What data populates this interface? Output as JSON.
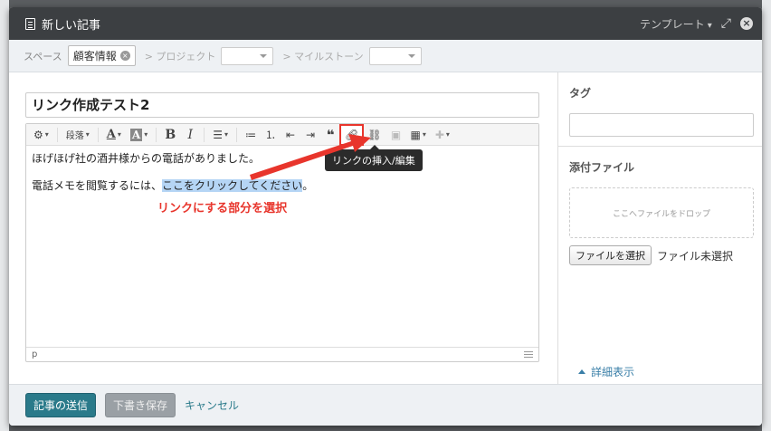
{
  "modal": {
    "title": "新しい記事",
    "template_label": "テンプレート"
  },
  "meta": {
    "space_label": "スペース",
    "space_value": "顧客情報",
    "project_label": "> プロジェクト",
    "milestone_label": "> マイルストーン"
  },
  "editor": {
    "title_value": "リンク作成テスト2",
    "toolbar": {
      "paragraph_label": "段落"
    },
    "content": {
      "line1": "ほげほげ社の酒井様からの電話がありました。",
      "line2_before": "電話メモを閲覧するには、",
      "line2_selected": "ここをクリックしてください",
      "line2_after": "。"
    },
    "status_path": "p",
    "tooltip": "リンクの挿入/編集"
  },
  "annotation": {
    "text": "リンクにする部分を選択",
    "color": "#e8352c"
  },
  "sidebar": {
    "tags_label": "タグ",
    "attachments_label": "添付ファイル",
    "dropzone_text": "ここへファイルをドロップ",
    "file_button": "ファイルを選択",
    "file_status": "ファイル未選択",
    "details_link": "詳細表示"
  },
  "footer": {
    "submit": "記事の送信",
    "draft": "下書き保存",
    "cancel": "キャンセル"
  },
  "colors": {
    "accent": "#2a7a8a",
    "highlight": "#e8352c",
    "selection": "#b5d5f5"
  }
}
